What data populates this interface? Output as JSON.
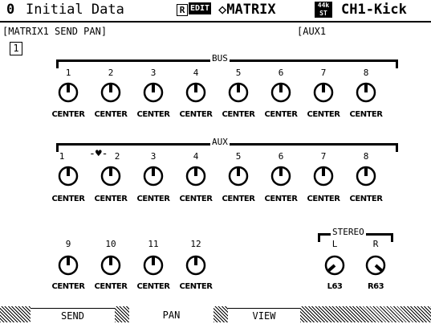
{
  "header": {
    "scene_number": "0",
    "scene_name": "Initial Data",
    "r_badge": "R",
    "edit_badge": "EDIT",
    "screen_title": "◇MATRIX",
    "fs_badge_top": "44k",
    "fs_badge_bottom": "ST",
    "channel": "CH1-Kick"
  },
  "section_title": "[MATRIX1 SEND PAN]",
  "aux_title": "[AUX1",
  "page_number": "1",
  "bus": {
    "label": "BUS",
    "numbers": [
      "1",
      "2",
      "3",
      "4",
      "5",
      "6",
      "7",
      "8"
    ],
    "values": [
      "CENTER",
      "CENTER",
      "CENTER",
      "CENTER",
      "CENTER",
      "CENTER",
      "CENTER",
      "CENTER"
    ]
  },
  "aux": {
    "label": "AUX",
    "numbers": [
      "1",
      "2",
      "3",
      "4",
      "5",
      "6",
      "7",
      "8"
    ],
    "values": [
      "CENTER",
      "CENTER",
      "CENTER",
      "CENTER",
      "CENTER",
      "CENTER",
      "CENTER",
      "CENTER"
    ]
  },
  "aux_extra": {
    "numbers": [
      "9",
      "10",
      "11",
      "12"
    ],
    "values": [
      "CENTER",
      "CENTER",
      "CENTER",
      "CENTER"
    ]
  },
  "stereo": {
    "label": "STEREO",
    "left_label": "L",
    "right_label": "R",
    "left_value": "L63",
    "right_value": "R63"
  },
  "tabs": [
    "SEND",
    "PAN",
    "VIEW"
  ],
  "icons": {
    "link": "heart-link-icon",
    "knob": "pan-knob-icon"
  }
}
